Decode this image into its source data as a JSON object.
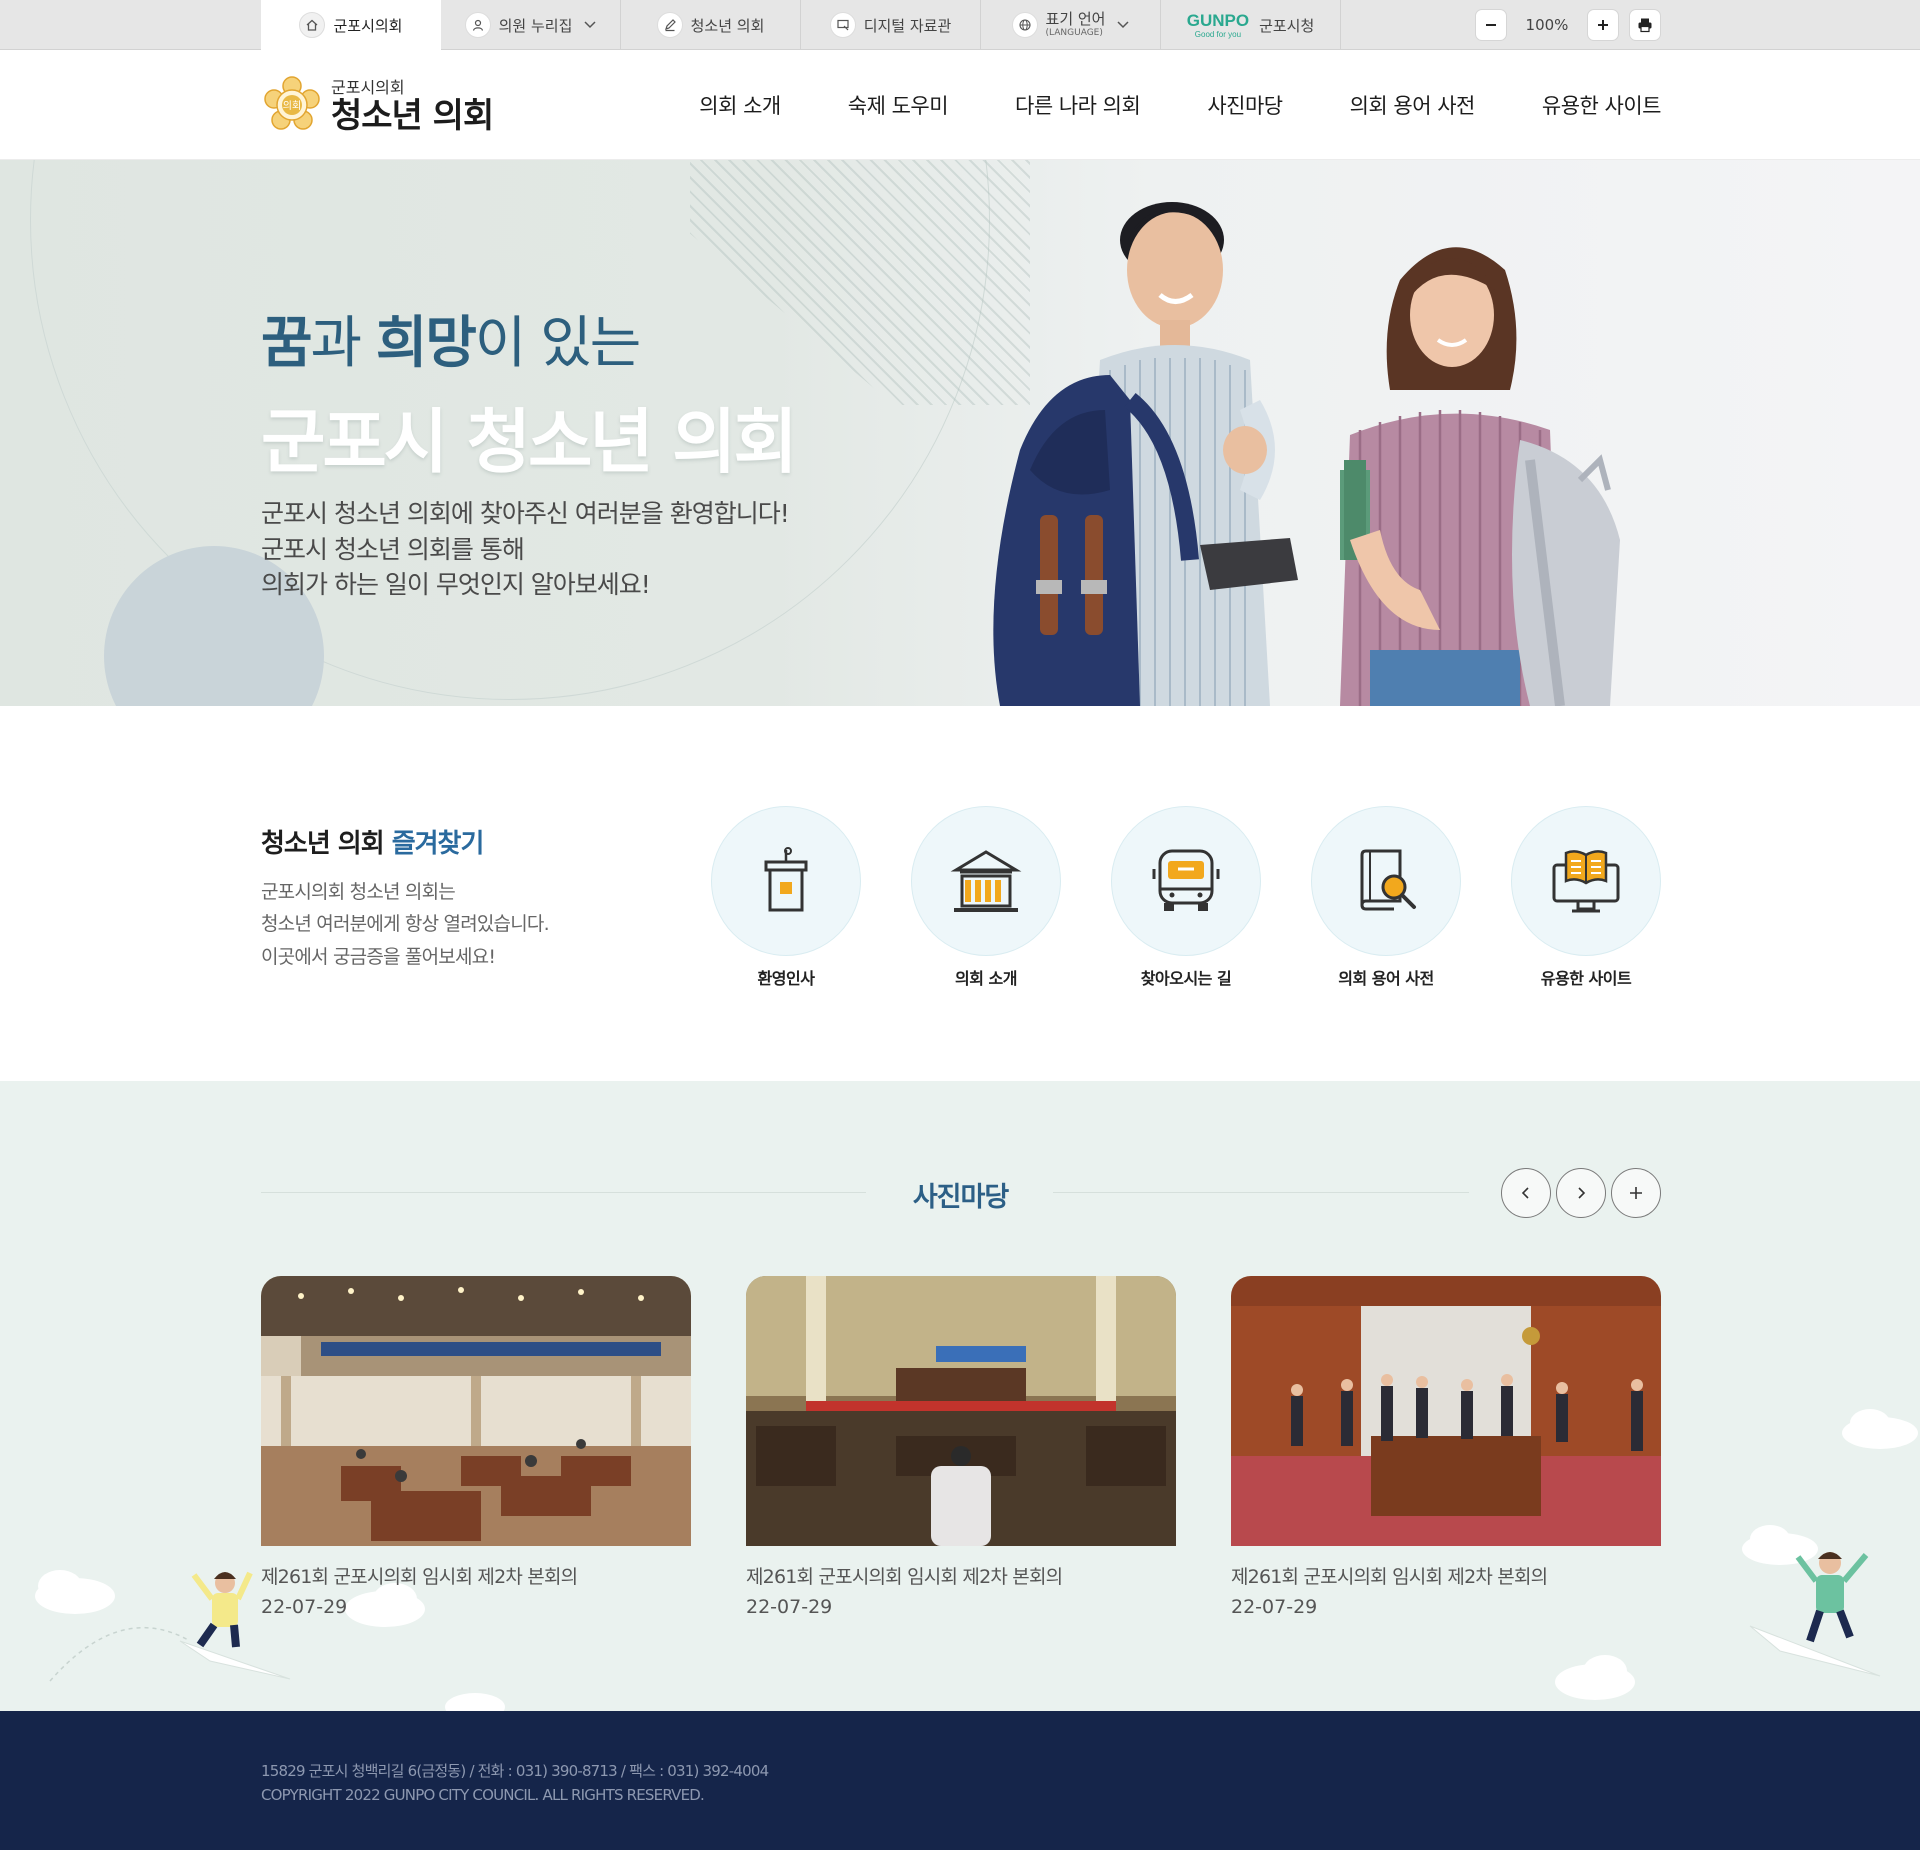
{
  "utilbar": {
    "tabs": [
      {
        "label": "군포시의회",
        "icon": "home-icon"
      },
      {
        "label": "의원 누리집",
        "icon": "user-icon"
      },
      {
        "label": "청소년 의회",
        "icon": "pencil-icon"
      },
      {
        "label": "디지털 자료관",
        "icon": "monitor-icon"
      },
      {
        "label": "표기 언어",
        "sub": "(LANGUAGE)",
        "icon": "globe-icon"
      },
      {
        "label": "군포시청",
        "logo": "GUNPO",
        "slogan": "Good for you"
      }
    ],
    "zoom_value": "100%"
  },
  "header": {
    "logo_sub": "군포시의회",
    "logo_main": "청소년 의회",
    "logo_emblem_text": "의회",
    "nav": [
      "의회 소개",
      "숙제 도우미",
      "다른 나라 의회",
      "사진마당",
      "의회 용어 사전",
      "유용한 사이트"
    ]
  },
  "hero": {
    "kicker_a": "꿈",
    "kicker_b": "과 ",
    "kicker_c": "희망",
    "kicker_d": "이 있는",
    "title": "군포시 청소년 의회",
    "desc": [
      "군포시 청소년 의회에 찾아주신 여러분을 환영합니다!",
      "군포시 청소년 의회를 통해",
      "의회가 하는 일이 무엇인지 알아보세요!"
    ]
  },
  "quick": {
    "title_a": "청소년 의회 ",
    "title_b": "즐겨찾기",
    "desc": [
      "군포시의회 청소년 의회는",
      "청소년 여러분에게 항상 열려있습니다.",
      "이곳에서 궁금증을 풀어보세요!"
    ],
    "items": [
      {
        "label": "환영인사",
        "icon": "podium-icon"
      },
      {
        "label": "의회 소개",
        "icon": "building-icon"
      },
      {
        "label": "찾아오시는 길",
        "icon": "bus-icon"
      },
      {
        "label": "의회 용어 사전",
        "icon": "book-search-icon"
      },
      {
        "label": "유용한 사이트",
        "icon": "computer-book-icon"
      }
    ]
  },
  "gallery": {
    "title": "사진마당",
    "cards": [
      {
        "title": "제261회 군포시의회 임시회 제2차 본회의",
        "date": "22-07-29"
      },
      {
        "title": "제261회 군포시의회 임시회 제2차 본회의",
        "date": "22-07-29"
      },
      {
        "title": "제261회 군포시의회 임시회 제2차 본회의",
        "date": "22-07-29"
      }
    ]
  },
  "footer": {
    "address": "15829 군포시 청백리길 6(금정동) / 전화 : 031) 390-8713 / 팩스 : 031) 392-4004",
    "copyright": "COPYRIGHT 2022 GUNPO CITY COUNCIL. ALL RIGHTS RESERVED."
  },
  "colors": {
    "accent_blue": "#2c5f86",
    "gunpo_green": "#2aa88f",
    "footer_navy": "#15254a",
    "gallery_bg": "#eaf2ef",
    "icon_orange": "#f2a81d"
  }
}
